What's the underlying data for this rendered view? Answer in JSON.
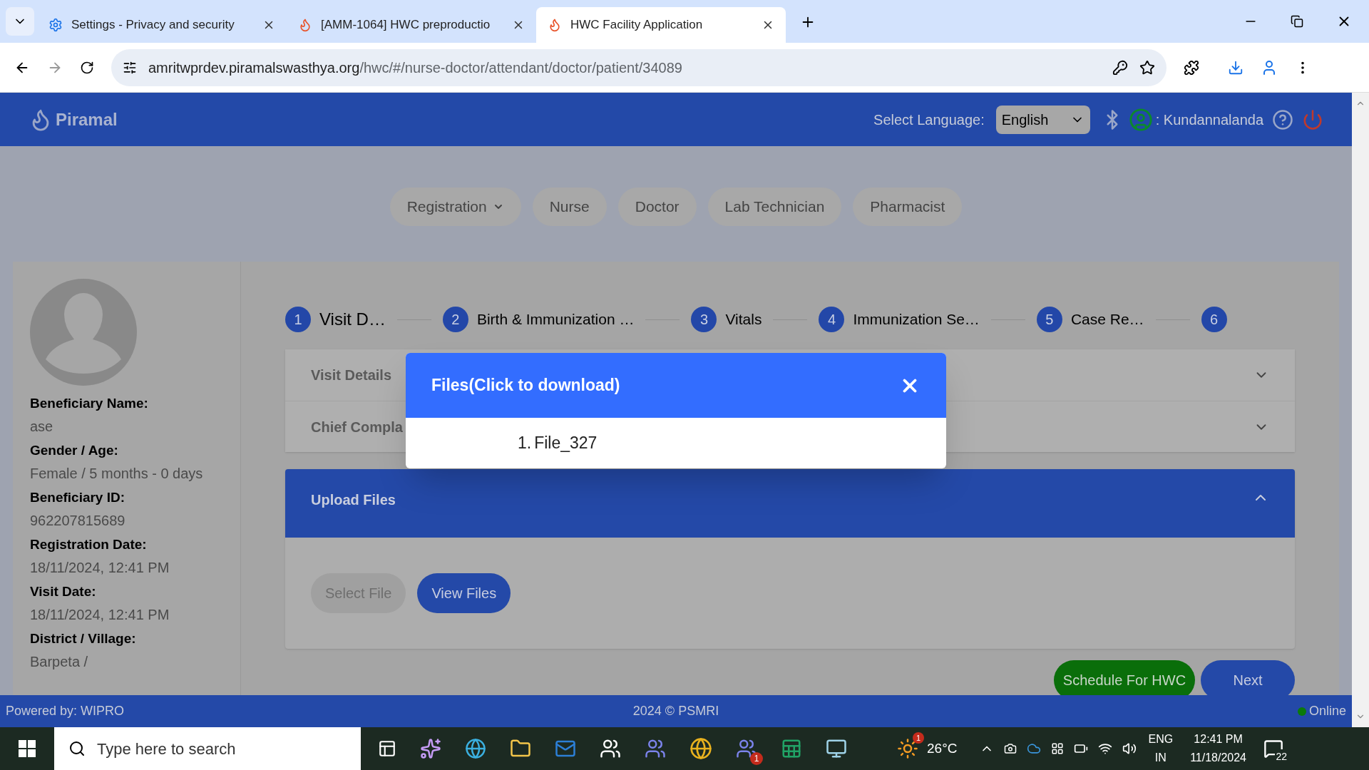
{
  "browser": {
    "tabs": [
      {
        "title": "Settings - Privacy and security",
        "kind": "settings",
        "selected": false
      },
      {
        "title": "[AMM-1064] HWC preproductio",
        "kind": "app",
        "selected": false
      },
      {
        "title": "HWC Facility Application",
        "kind": "app",
        "selected": true
      }
    ],
    "url_host": "amritwprdev.piramalswasthya.org",
    "url_path": "/hwc/#/nurse-doctor/attendant/doctor/patient/34089"
  },
  "header": {
    "logo": "Piramal",
    "language_label": "Select Language:",
    "language": "English",
    "user": ": Kundannalanda"
  },
  "nav": [
    {
      "label": "Registration",
      "kind": "dropdown"
    },
    {
      "label": "Nurse",
      "kind": "plain"
    },
    {
      "label": "Doctor",
      "kind": "plain"
    },
    {
      "label": "Lab Technician",
      "kind": "plain"
    },
    {
      "label": "Pharmacist",
      "kind": "plain"
    }
  ],
  "patient": [
    {
      "label": "Beneficiary Name:",
      "value": "ase"
    },
    {
      "label": "Gender / Age:",
      "value": "Female / 5 months - 0 days"
    },
    {
      "label": "Beneficiary ID:",
      "value": "962207815689"
    },
    {
      "label": "Registration Date:",
      "value": "18/11/2024, 12:41 PM"
    },
    {
      "label": "Visit Date:",
      "value": "18/11/2024, 12:41 PM"
    },
    {
      "label": "District / Village:",
      "value": "Barpeta /"
    }
  ],
  "steps": [
    {
      "number": "1",
      "label": "Visit D…"
    },
    {
      "number": "2",
      "label": "Birth & Immunization …"
    },
    {
      "number": "3",
      "label": "Vitals"
    },
    {
      "number": "4",
      "label": "Immunization Se…"
    },
    {
      "number": "5",
      "label": "Case Re…"
    },
    {
      "number": "6"
    }
  ],
  "sections": [
    {
      "title": "Visit Details",
      "expanded": false
    },
    {
      "title": "Chief Compla",
      "expanded": false
    }
  ],
  "upload": {
    "title": "Upload Files",
    "expanded": true,
    "buttons": [
      {
        "label": "Select File",
        "disabled": true
      },
      {
        "label": "View Files",
        "disabled": false
      }
    ]
  },
  "actions": [
    {
      "label": "Schedule For HWC",
      "kind": "success"
    },
    {
      "label": "Next",
      "kind": "primary"
    }
  ],
  "modal": {
    "title": "Files(Click to download)",
    "files": [
      {
        "number": "1.",
        "name": "File_327"
      }
    ]
  },
  "footer": {
    "left": "Powered by: WIPRO",
    "center": "2024 © PSMRI",
    "status": "Online"
  },
  "taskbar": {
    "search_placeholder": "Type here to search",
    "teams_badge": "1",
    "weather_badge": "1",
    "temperature": "26°C",
    "lang_top": "ENG",
    "lang_bottom": "IN",
    "time": "12:41 PM",
    "date": "11/18/2024",
    "notifications": "22"
  }
}
